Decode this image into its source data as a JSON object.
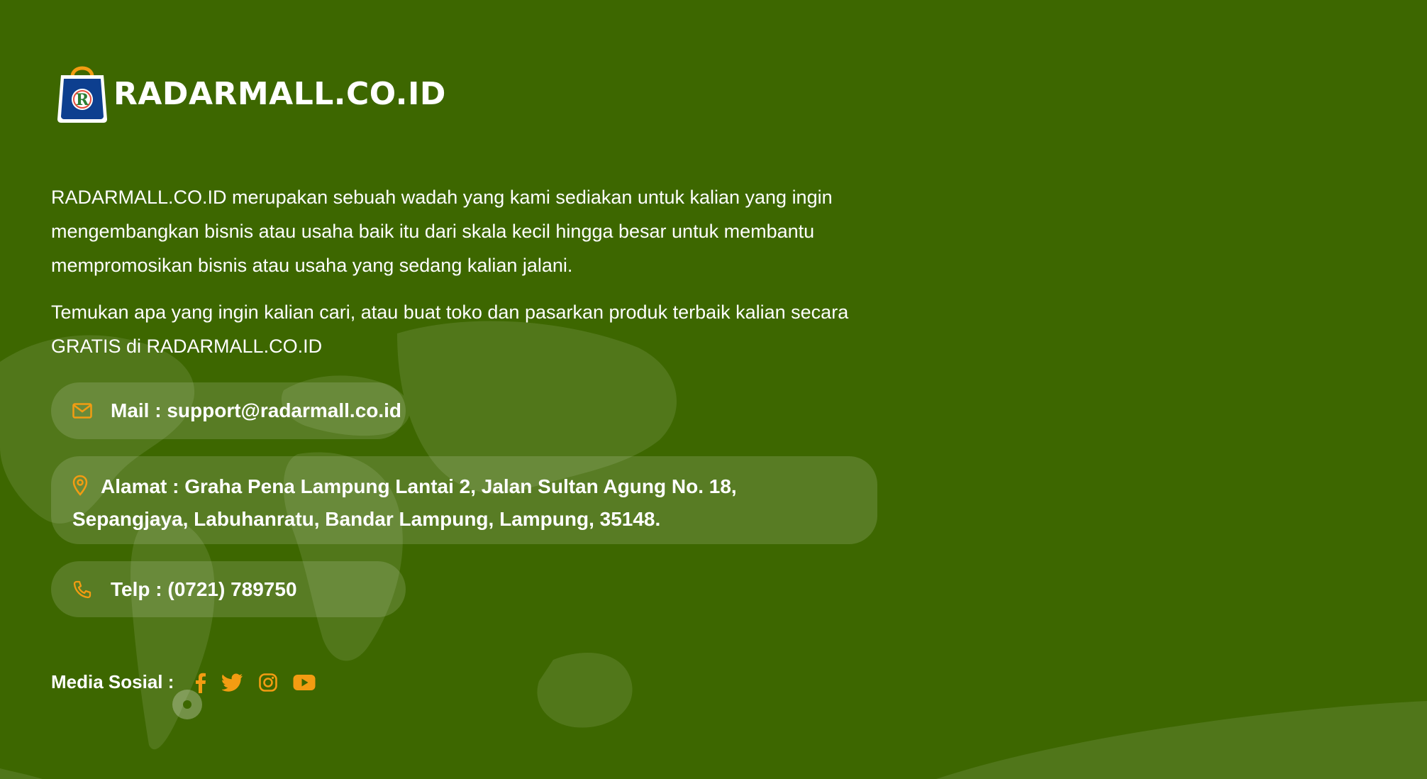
{
  "brand": {
    "name": "RADARMALL.CO.ID",
    "logo_letter": "R",
    "colors": {
      "background": "#3d6700",
      "accent": "#f39c12",
      "bag": "#0d3f8f"
    }
  },
  "about": {
    "paragraph1": "RADARMALL.CO.ID merupakan sebuah wadah yang kami sediakan untuk kalian yang ingin mengembangkan bisnis atau usaha baik itu dari skala kecil hingga besar untuk membantu mempromosikan bisnis atau usaha yang sedang kalian jalani.",
    "paragraph2": "Temukan apa yang ingin kalian cari, atau buat toko dan pasarkan produk terbaik kalian secara GRATIS di RADARMALL.CO.ID"
  },
  "contact": {
    "mail": {
      "icon": "envelope-icon",
      "text": "Mail : support@radarmall.co.id"
    },
    "address": {
      "icon": "map-pin-icon",
      "text": "Alamat : Graha Pena Lampung Lantai 2, Jalan Sultan Agung No. 18, Sepangjaya, Labuhanratu, Bandar Lampung, Lampung, 35148."
    },
    "phone": {
      "icon": "phone-icon",
      "text": "Telp : (0721) 789750"
    }
  },
  "social": {
    "label": "Media Sosial :",
    "links": [
      {
        "icon": "facebook-icon"
      },
      {
        "icon": "twitter-icon"
      },
      {
        "icon": "instagram-icon"
      },
      {
        "icon": "youtube-icon"
      }
    ]
  }
}
